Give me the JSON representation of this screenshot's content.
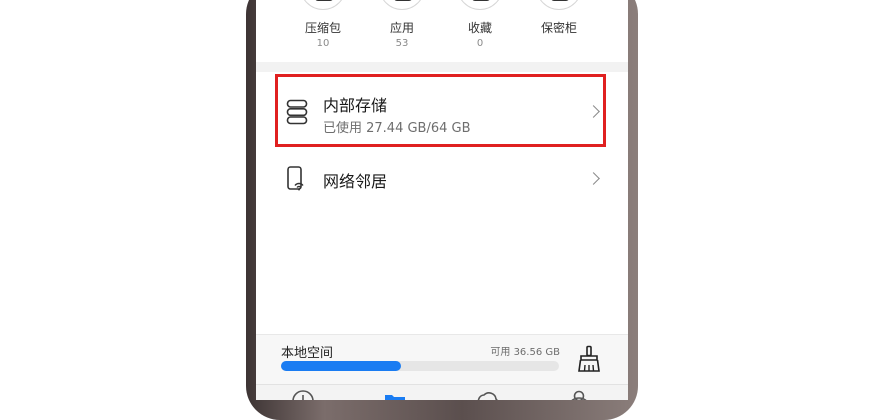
{
  "categories": [
    {
      "label": "压缩包",
      "count": "10"
    },
    {
      "label": "应用",
      "count": "53"
    },
    {
      "label": "收藏",
      "count": "0"
    },
    {
      "label": "保密柜",
      "count": ""
    }
  ],
  "storage_items": [
    {
      "title": "内部存储",
      "subtitle": "已使用 27.44 GB/64 GB",
      "icon": "storage-icon",
      "highlighted": true
    },
    {
      "title": "网络邻居",
      "icon": "network-phone-icon"
    }
  ],
  "local_space": {
    "title": "本地空间",
    "available": "可用 36.56 GB",
    "used_fraction": 0.43,
    "icon": "broom-clean-icon"
  },
  "bottom_tabs": [
    {
      "icon": "recent-clock-icon"
    },
    {
      "icon": "browse-folder-icon",
      "active": true
    },
    {
      "icon": "cloud-icon"
    },
    {
      "icon": "profile-icon"
    }
  ],
  "colors": {
    "accent": "#1a7cf2",
    "highlight_box": "#e02020",
    "text_primary": "#1a1a1a",
    "text_secondary": "#6e6e6e"
  }
}
